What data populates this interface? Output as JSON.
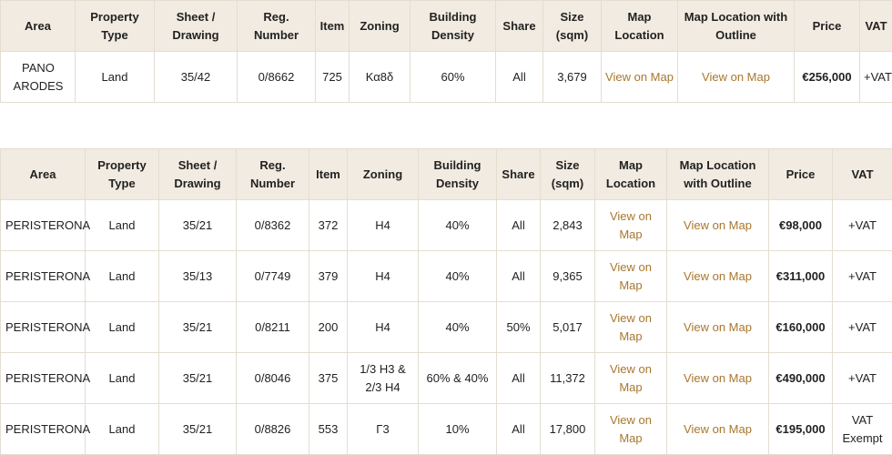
{
  "headers": [
    "Area",
    "Property Type",
    "Sheet / Drawing",
    "Reg. Number",
    "Item",
    "Zoning",
    "Building Density",
    "Share",
    "Size (sqm)",
    "Map Location",
    "Map Location with Outline",
    "Price",
    "VAT"
  ],
  "headers_display_t1": [
    "Area",
    "Property\nType",
    "Sheet /\nDrawing",
    "Reg.\nNumber",
    "Item",
    "Zoning",
    "Building\nDensity",
    "Share",
    "Size\n(sqm)",
    "Map\nLocation",
    "Map Location with\nOutline",
    "Price",
    "VAT"
  ],
  "headers_display_t2": [
    "Area",
    "Property\nType",
    "Sheet /\nDrawing",
    "Reg.\nNumber",
    "Item",
    "Zoning",
    "Building\nDensity",
    "Share",
    "Size\n(sqm)",
    "Map\nLocation",
    "Map Location\nwith Outline",
    "Price",
    "VAT"
  ],
  "table1": [
    {
      "area": "PANO ARODES",
      "type": "Land",
      "sheet": "35/42",
      "reg": "0/8662",
      "item": "725",
      "zoning": "Κα8δ",
      "density": "60%",
      "share": "All",
      "size": "3,679",
      "map": "View on Map",
      "outline": "View on Map",
      "price": "€256,000",
      "vat": "+VAT"
    }
  ],
  "table2": [
    {
      "area": "PERISTERONA",
      "type": "Land",
      "sheet": "35/21",
      "reg": "0/8362",
      "item": "372",
      "zoning": "H4",
      "density": "40%",
      "share": "All",
      "size": "2,843",
      "map": "View on Map",
      "outline": "View on Map",
      "price": "€98,000",
      "vat": "+VAT"
    },
    {
      "area": "PERISTERONA",
      "type": "Land",
      "sheet": "35/13",
      "reg": "0/7749",
      "item": "379",
      "zoning": "H4",
      "density": "40%",
      "share": "All",
      "size": "9,365",
      "map": "View on Map",
      "outline": "View on Map",
      "price": "€311,000",
      "vat": "+VAT"
    },
    {
      "area": "PERISTERONA",
      "type": "Land",
      "sheet": "35/21",
      "reg": "0/8211",
      "item": "200",
      "zoning": "H4",
      "density": "40%",
      "share": "50%",
      "size": "5,017",
      "map": "View on Map",
      "outline": "View on Map",
      "price": "€160,000",
      "vat": "+VAT"
    },
    {
      "area": "PERISTERONA",
      "type": "Land",
      "sheet": "35/21",
      "reg": "0/8046",
      "item": "375",
      "zoning": "1/3 H3 & 2/3 H4",
      "density": "60% & 40%",
      "share": "All",
      "size": "11,372",
      "map": "View on Map",
      "outline": "View on Map",
      "price": "€490,000",
      "vat": "+VAT"
    },
    {
      "area": "PERISTERONA",
      "type": "Land",
      "sheet": "35/21",
      "reg": "0/8826",
      "item": "553",
      "zoning": "Γ3",
      "density": "10%",
      "share": "All",
      "size": "17,800",
      "map": "View on Map",
      "outline": "View on Map",
      "price": "€195,000",
      "vat": "VAT Exempt"
    }
  ],
  "colors": {
    "header_bg": "#f1ebe1",
    "link": "#a8772e",
    "border": "#e4ddd0"
  }
}
